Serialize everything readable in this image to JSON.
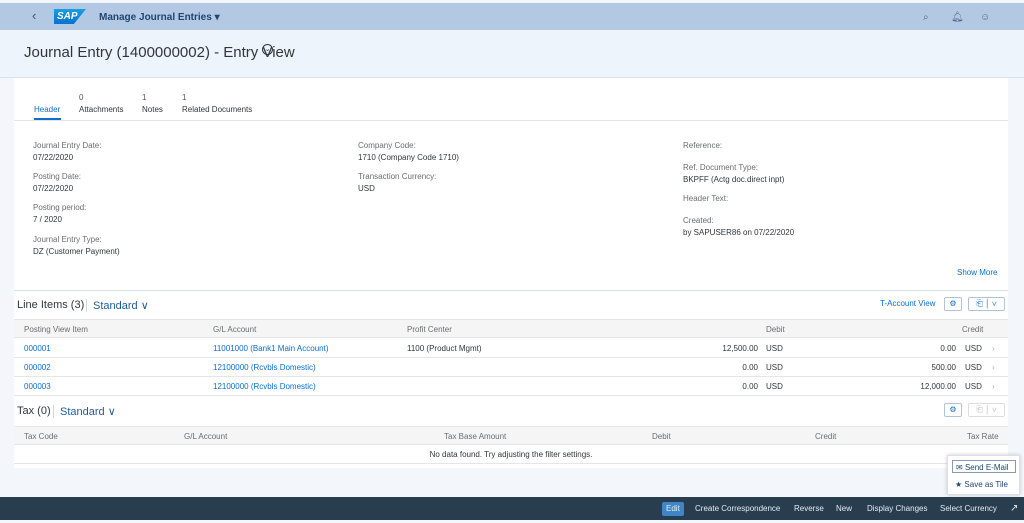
{
  "shell": {
    "app_title": "Manage Journal Entries ▾",
    "logo": "SAP",
    "icons": [
      "back-icon",
      "search-icon",
      "bell-icon",
      "user-icon"
    ]
  },
  "page": {
    "title": "Journal Entry (1400000002) - Entry View"
  },
  "tabs": [
    {
      "count": "",
      "label": "Header"
    },
    {
      "count": "0",
      "label": "Attachments"
    },
    {
      "count": "1",
      "label": "Notes"
    },
    {
      "count": "1",
      "label": "Related Documents"
    }
  ],
  "header_fields": {
    "col1": [
      {
        "label": "Journal Entry Date:",
        "value": "07/22/2020"
      },
      {
        "label": "Posting Date:",
        "value": "07/22/2020"
      },
      {
        "label": "Posting period:",
        "value": "7 / 2020"
      },
      {
        "label": "Journal Entry Type:",
        "value": "DZ (Customer Payment)"
      }
    ],
    "col2": [
      {
        "label": "Company Code:",
        "value": "1710 (Company Code 1710)"
      },
      {
        "label": "Transaction Currency:",
        "value": "USD"
      }
    ],
    "col3": [
      {
        "label": "Reference:",
        "value": ""
      },
      {
        "label": "Ref. Document Type:",
        "value": "BKPFF (Actg doc.direct inpt)"
      },
      {
        "label": "Header Text:",
        "value": ""
      },
      {
        "label": "Created:",
        "value": "by SAPUSER86 on 07/22/2020"
      }
    ]
  },
  "show_more": "Show More",
  "line_items": {
    "title": "Line Items (3)",
    "variant": "Standard",
    "t_account": "T-Account View",
    "columns": [
      "Posting View Item",
      "G/L Account",
      "Profit Center",
      "Debit",
      "Credit"
    ],
    "rows": [
      {
        "item": "000001",
        "account": "11001000 (Bank1 Main Account)",
        "profit_center": "1100 (Product Mgmt)",
        "debit": "12,500.00",
        "debit_cur": "USD",
        "credit": "0.00",
        "credit_cur": "USD"
      },
      {
        "item": "000002",
        "account": "12100000 (Rcvbls Domestic)",
        "profit_center": "",
        "debit": "0.00",
        "debit_cur": "USD",
        "credit": "500.00",
        "credit_cur": "USD"
      },
      {
        "item": "000003",
        "account": "12100000 (Rcvbls Domestic)",
        "profit_center": "",
        "debit": "0.00",
        "debit_cur": "USD",
        "credit": "12,000.00",
        "credit_cur": "USD"
      }
    ]
  },
  "tax": {
    "title": "Tax (0)",
    "variant": "Standard",
    "columns": [
      "Tax Code",
      "G/L Account",
      "Tax Base Amount",
      "Debit",
      "Credit",
      "Tax Rate"
    ],
    "no_data": "No data found. Try adjusting the filter settings."
  },
  "popover": {
    "items": [
      "Send E-Mail",
      "Save as Tile"
    ]
  },
  "footer": {
    "buttons": [
      "Edit",
      "Create Correspondence",
      "Reverse",
      "New",
      "Display Changes",
      "Select Currency"
    ]
  }
}
